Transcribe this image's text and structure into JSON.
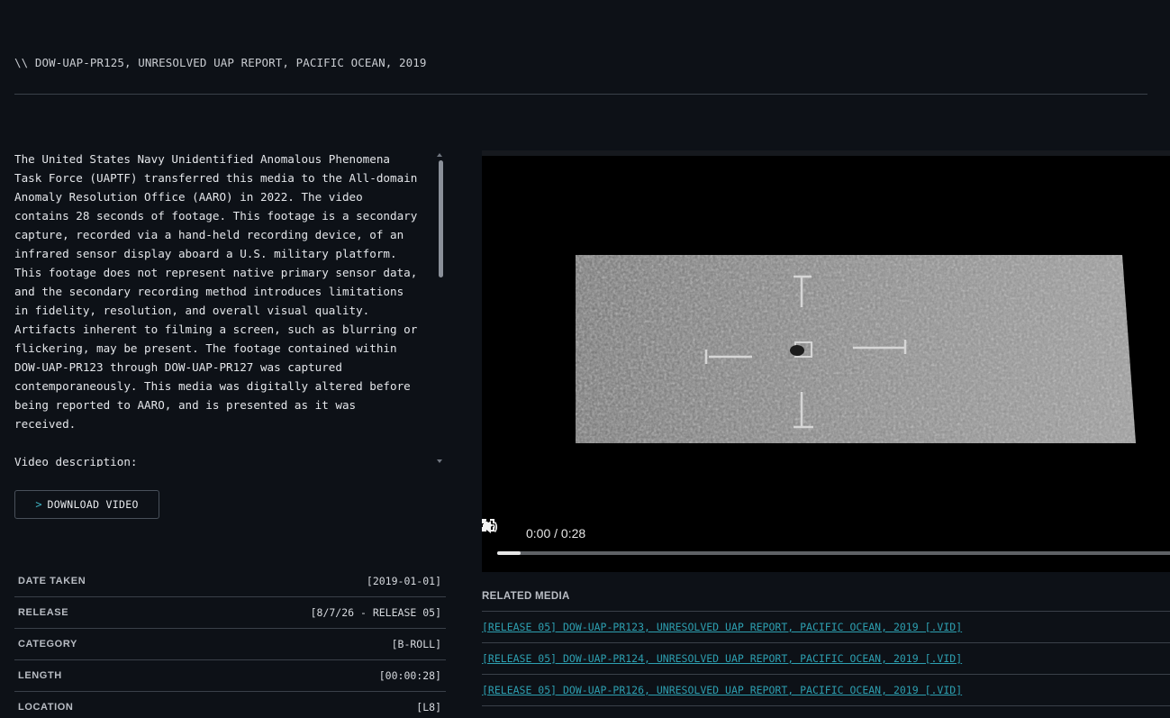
{
  "header": {
    "title": "\\\\  DOW-UAP-PR125, UNRESOLVED UAP REPORT, PACIFIC OCEAN, 2019"
  },
  "description": {
    "text": "The United States Navy Unidentified Anomalous Phenomena\nTask Force (UAPTF) transferred this media to the All-domain\nAnomaly Resolution Office (AARO) in 2022. The video\ncontains 28 seconds of footage. This footage is a secondary\ncapture, recorded via a hand-held recording device, of an\ninfrared sensor display aboard a U.S. military platform.\nThis footage does not represent native primary sensor data,\nand the secondary recording method introduces limitations\nin fidelity, resolution, and overall visual quality.\nArtifacts inherent to filming a screen, such as blurring or\nflickering, may be present. The footage contained within\nDOW-UAP-PR123 through DOW-UAP-PR127 was captured\ncontemporaneously. This media was digitally altered before\nbeing reported to AARO, and is presented as it was\nreceived.",
    "section_label": "Video description:"
  },
  "download": {
    "icon": "chevron-right-icon",
    "label": "DOWNLOAD VIDEO"
  },
  "metadata": [
    {
      "key": "DATE TAKEN",
      "value": "[2019-01-01]"
    },
    {
      "key": "RELEASE",
      "value": "[8/7/26 - RELEASE 05]"
    },
    {
      "key": "CATEGORY",
      "value": "[B-ROLL]"
    },
    {
      "key": "LENGTH",
      "value": "[00:00:28]"
    },
    {
      "key": "LOCATION",
      "value": "[L8]"
    }
  ],
  "video_player": {
    "time_display": "0:00 / 0:28",
    "progress": 0.035,
    "icons": [
      "play-icon",
      "volume-icon",
      "fullscreen-icon"
    ]
  },
  "related_media": {
    "title": "RELATED MEDIA",
    "items": [
      "[RELEASE 05] DOW-UAP-PR123, UNRESOLVED UAP REPORT, PACIFIC OCEAN, 2019 [.VID]",
      "[RELEASE 05] DOW-UAP-PR124, UNRESOLVED UAP REPORT, PACIFIC OCEAN, 2019 [.VID]",
      "[RELEASE 05] DOW-UAP-PR126, UNRESOLVED UAP REPORT, PACIFIC OCEAN, 2019 [.VID]"
    ]
  },
  "colors": {
    "background": "#0d1117",
    "link": "#2d9fb0",
    "accent": "#3fb3c2",
    "divider": "#3a4049"
  }
}
